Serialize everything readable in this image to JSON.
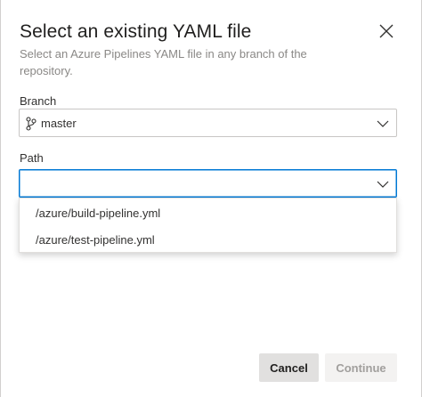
{
  "dialog": {
    "title": "Select an existing YAML file",
    "subtitle": "Select an Azure Pipelines YAML file in any branch of the repository."
  },
  "branch": {
    "label": "Branch",
    "value": "master",
    "icon": "git-branch-icon"
  },
  "path": {
    "label": "Path",
    "value": "",
    "options": [
      "/azure/build-pipeline.yml",
      "/azure/test-pipeline.yml"
    ]
  },
  "buttons": {
    "cancel": "Cancel",
    "continue": "Continue",
    "continue_enabled": false
  },
  "colors": {
    "focus_border": "#0078d4",
    "muted_text": "#8a8886",
    "cancel_bg": "#e1e0df",
    "disabled_bg": "#f3f2f1"
  }
}
